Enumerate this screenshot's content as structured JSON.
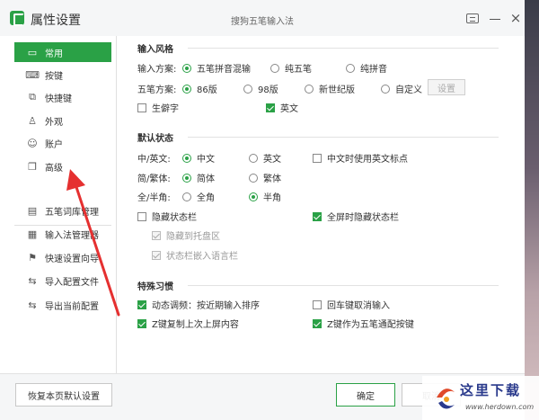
{
  "window": {
    "app_title": "属性设置",
    "center_title": "搜狗五笔输入法"
  },
  "sidebar": {
    "items": [
      {
        "label": "常用",
        "icon": "monitor-icon"
      },
      {
        "label": "按键",
        "icon": "keyboard-icon"
      },
      {
        "label": "快捷键",
        "icon": "shortcut-icon"
      },
      {
        "label": "外观",
        "icon": "shirt-icon"
      },
      {
        "label": "账户",
        "icon": "user-icon"
      },
      {
        "label": "高级",
        "icon": "layers-icon"
      },
      {
        "label": "五笔词库管理",
        "icon": "dictionary-icon"
      },
      {
        "label": "输入法管理器",
        "icon": "grid-icon"
      },
      {
        "label": "快速设置向导",
        "icon": "flag-icon"
      },
      {
        "label": "导入配置文件",
        "icon": "import-icon"
      },
      {
        "label": "导出当前配置",
        "icon": "export-icon"
      }
    ]
  },
  "input_style": {
    "title": "输入风格",
    "scheme_label": "输入方案:",
    "scheme_options": [
      "五笔拼音混输",
      "纯五笔",
      "纯拼音"
    ],
    "wubi_label": "五笔方案:",
    "wubi_options": [
      "86版",
      "98版",
      "新世纪版",
      "自定义"
    ],
    "settings_button": "设置",
    "rare_chars": "生僻字",
    "english": "英文"
  },
  "default_state": {
    "title": "默认状态",
    "cn_en_label": "中/英文:",
    "cn_en_options": [
      "中文",
      "英文"
    ],
    "cn_punct": "中文时使用英文标点",
    "simp_trad_label": "简/繁体:",
    "simp_trad_options": [
      "简体",
      "繁体"
    ],
    "width_label": "全/半角:",
    "width_options": [
      "全角",
      "半角"
    ],
    "hide_status": "隐藏状态栏",
    "fullscreen_hide": "全屏时隐藏状态栏",
    "hide_tray": "隐藏到托盘区",
    "embed_lang": "状态栏嵌入语言栏"
  },
  "special_habits": {
    "title": "特殊习惯",
    "dynamic_adjust": "动态调频：按近期输入排序",
    "enter_cancel": "回车键取消输入",
    "z_copy": "Z键复制上次上屏内容",
    "z_wildcard": "Z键作为五笔通配按键"
  },
  "footer": {
    "reset_button": "恢复本页默认设置",
    "ok_button": "确定",
    "cancel_button": "取消"
  },
  "watermark": {
    "text": "这里下载",
    "url": "www.herdown.com"
  },
  "colors": {
    "accent": "#2aa146",
    "arrow": "#e53030"
  }
}
